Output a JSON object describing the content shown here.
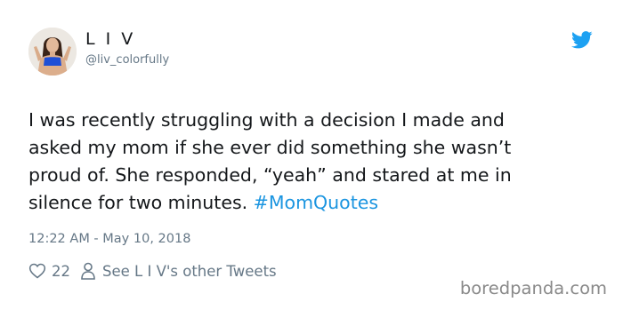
{
  "user": {
    "name": "L I V",
    "handle": "@liv_colorfully"
  },
  "icons": {
    "avatar": "profile-photo",
    "bird": "twitter-bird-icon",
    "heart": "heart-icon",
    "person": "person-icon"
  },
  "tweet": {
    "lines": [
      "I was recently struggling with a decision I made and",
      "asked my mom if she ever did something she wasn’t",
      "proud of. She responded, “yeah” and stared at me in"
    ],
    "last_line_text": "silence for two minutes.",
    "hashtag": "#MomQuotes",
    "timestamp": "12:22 AM - May 10, 2018"
  },
  "actions": {
    "like_count": "22",
    "see_other_tweets": "See L I V's other Tweets"
  },
  "watermark": "boredpanda.com",
  "colors": {
    "text": "#14171a",
    "secondary": "#657786",
    "link": "#1b95e0",
    "twitter_blue": "#1da1f2",
    "watermark": "#8a8a8a"
  }
}
